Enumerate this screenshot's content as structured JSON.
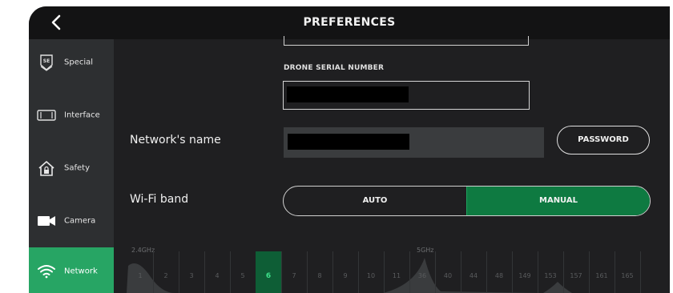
{
  "header": {
    "title": "PREFERENCES",
    "back_icon": "chevron-left-icon"
  },
  "sidebar": {
    "items": [
      {
        "label": "Special",
        "icon": "shield-se-icon",
        "active": false
      },
      {
        "label": "Interface",
        "icon": "phone-landscape-icon",
        "active": false
      },
      {
        "label": "Safety",
        "icon": "home-lock-icon",
        "active": false
      },
      {
        "label": "Camera",
        "icon": "video-camera-icon",
        "active": false
      },
      {
        "label": "Network",
        "icon": "wifi-icon",
        "active": true
      }
    ]
  },
  "form": {
    "serial_label": "DRONE SERIAL NUMBER",
    "network_name_label": "Network's name",
    "password_button": "PASSWORD",
    "wifi_band_label": "Wi-Fi band",
    "band_options": [
      "AUTO",
      "MANUAL"
    ],
    "band_selected": "MANUAL"
  },
  "spectrum": {
    "band_24_label": "2.4GHz",
    "band_5_label": "5GHz",
    "channels_24": [
      "1",
      "2",
      "3",
      "4",
      "5",
      "6",
      "7",
      "8",
      "9",
      "10",
      "11"
    ],
    "channels_5": [
      "36",
      "40",
      "44",
      "48",
      "149",
      "153",
      "157",
      "161",
      "165"
    ],
    "selected_channel": "6"
  },
  "colors": {
    "accent_green": "#27a564",
    "manual_fill": "#0e7a41",
    "background": "#1f1f21",
    "sidebar": "#2d2f31"
  }
}
